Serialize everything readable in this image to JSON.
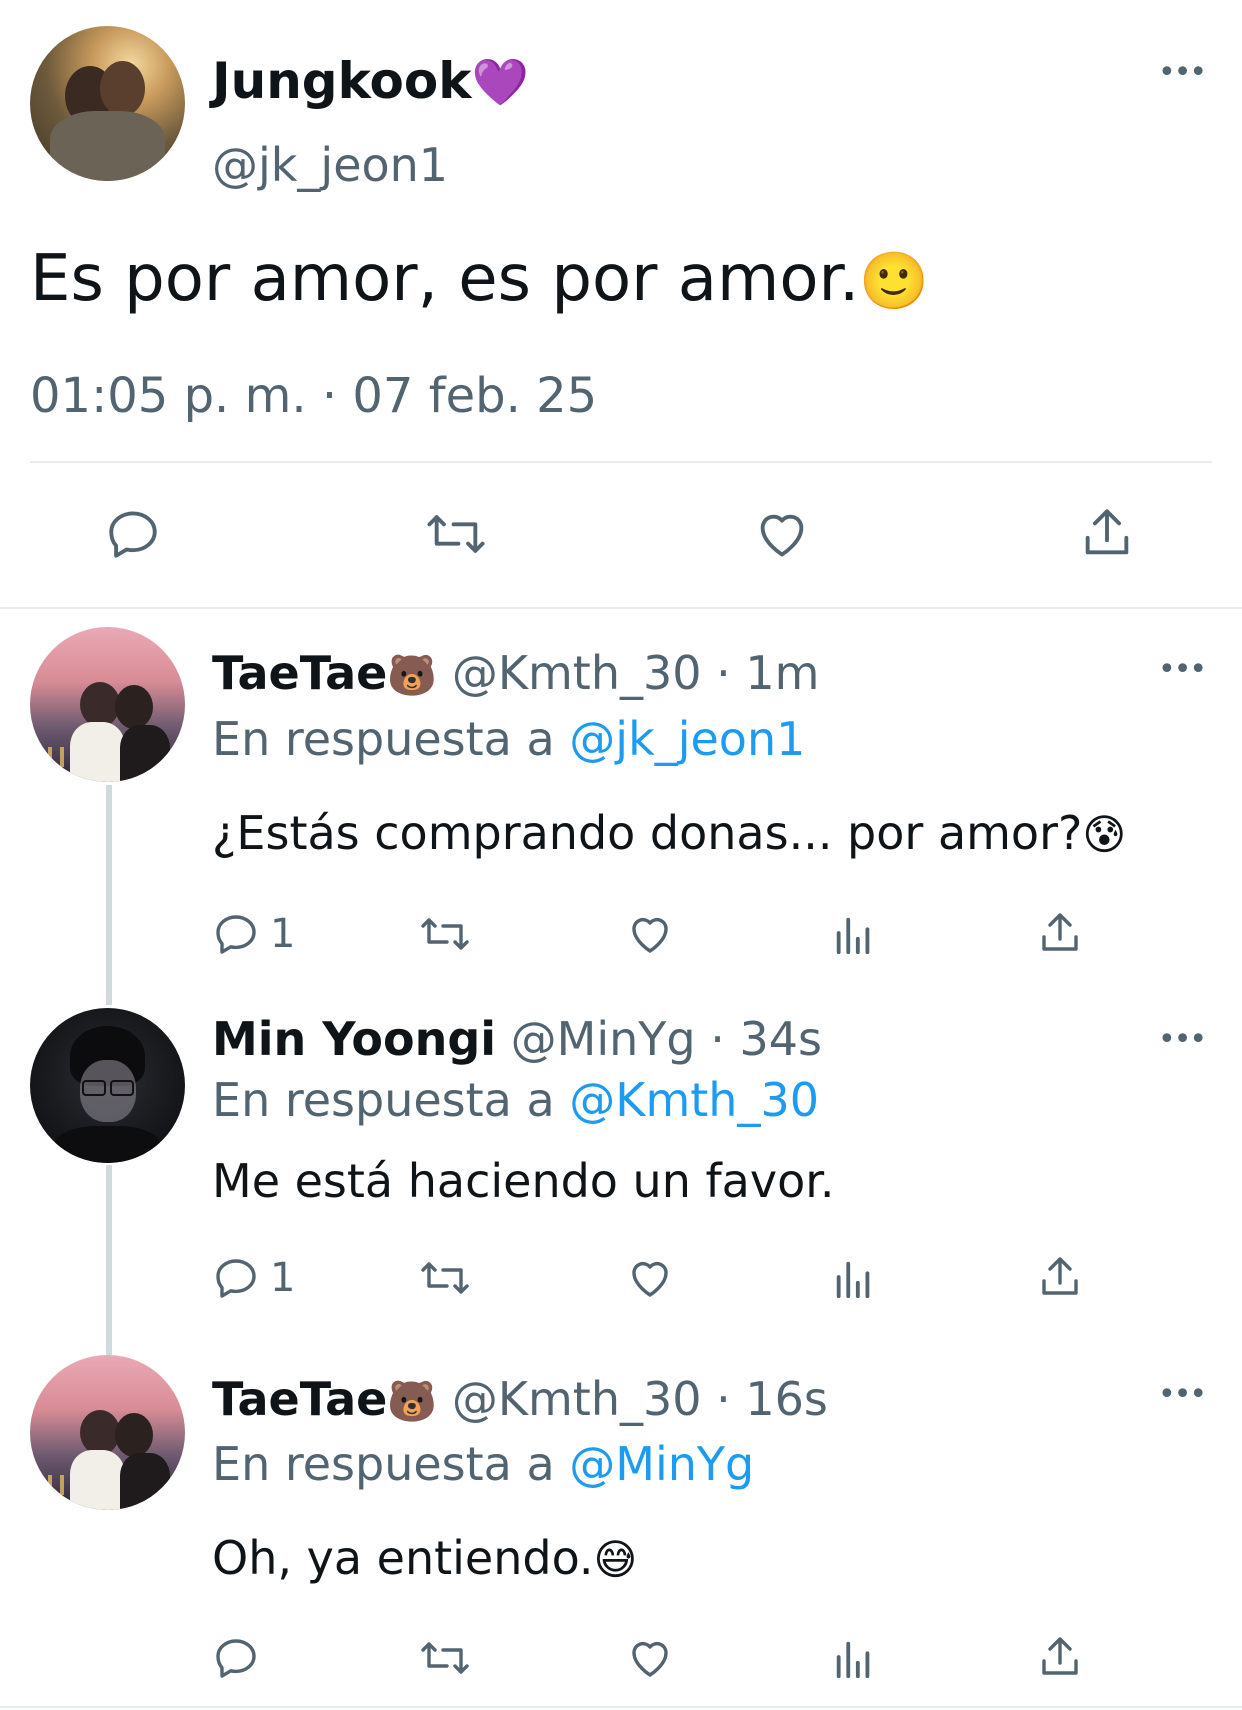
{
  "main_tweet": {
    "author_name": "Jungkook",
    "author_emoji": "💜",
    "handle": "@jk_jeon1",
    "text": "Es por amor, es por amor.",
    "text_emoji": "🙂",
    "timestamp": "01:05 p. m. · 07 feb. 25",
    "actions": [
      "reply-icon",
      "retweet-icon",
      "heart-icon",
      "share-icon"
    ]
  },
  "replies": [
    {
      "name": "TaeTae",
      "name_emoji": "🐻",
      "handle": "@Kmth_30",
      "time": "· 1m",
      "reply_prefix": "En respuesta a",
      "reply_to": "@jk_jeon1",
      "text": "¿Estás comprando donas... por amor?",
      "text_emoji": "😰",
      "reply_count": "1"
    },
    {
      "name": "Min Yoongi",
      "name_emoji": "",
      "handle": "@MinYg",
      "time": "· 34s",
      "reply_prefix": "En respuesta a",
      "reply_to": "@Kmth_30",
      "text": "Me está haciendo un favor.",
      "text_emoji": "",
      "reply_count": "1"
    },
    {
      "name": "TaeTae",
      "name_emoji": "🐻",
      "handle": "@Kmth_30",
      "time": "· 16s",
      "reply_prefix": "En respuesta a",
      "reply_to": "@MinYg",
      "text": "Oh, ya entiendo.",
      "text_emoji": "😅",
      "reply_count": ""
    }
  ],
  "more_glyph": "•••",
  "colors": {
    "text": "#0f1419",
    "secondary": "#536471",
    "link": "#1d9bf0",
    "divider": "#e6ecf0",
    "thread_line": "#cfd9de"
  }
}
